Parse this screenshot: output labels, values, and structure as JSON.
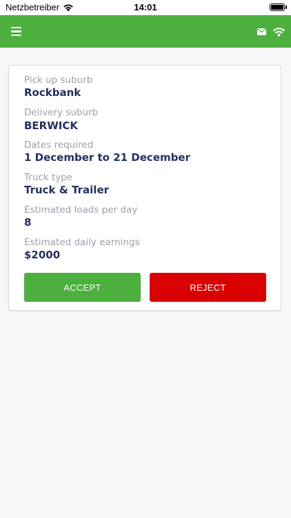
{
  "status_bar": {
    "carrier": "Netzbetreiber",
    "time": "14:01",
    "battery": "full"
  },
  "app_bar": {
    "background": "#4caf3e",
    "icons": [
      "menu-icon",
      "mail-icon",
      "wifi-icon"
    ]
  },
  "job": {
    "pickup_label": "Pick up suburb",
    "pickup_value": "Rockbank",
    "delivery_label": "Delivery suburb",
    "delivery_value": "BERWICK",
    "dates_label": "Dates required",
    "dates_value": "1 December to 21 December",
    "truck_label": "Truck type",
    "truck_value": "Truck & Trailer",
    "loads_label": "Estimated loads per day",
    "loads_value": "8",
    "earnings_label": "Estimated daily earnings",
    "earnings_value": "$2000"
  },
  "actions": {
    "accept_label": "ACCEPT",
    "accept_color": "#4caf3e",
    "reject_label": "REJECT",
    "reject_color": "#d90000"
  }
}
